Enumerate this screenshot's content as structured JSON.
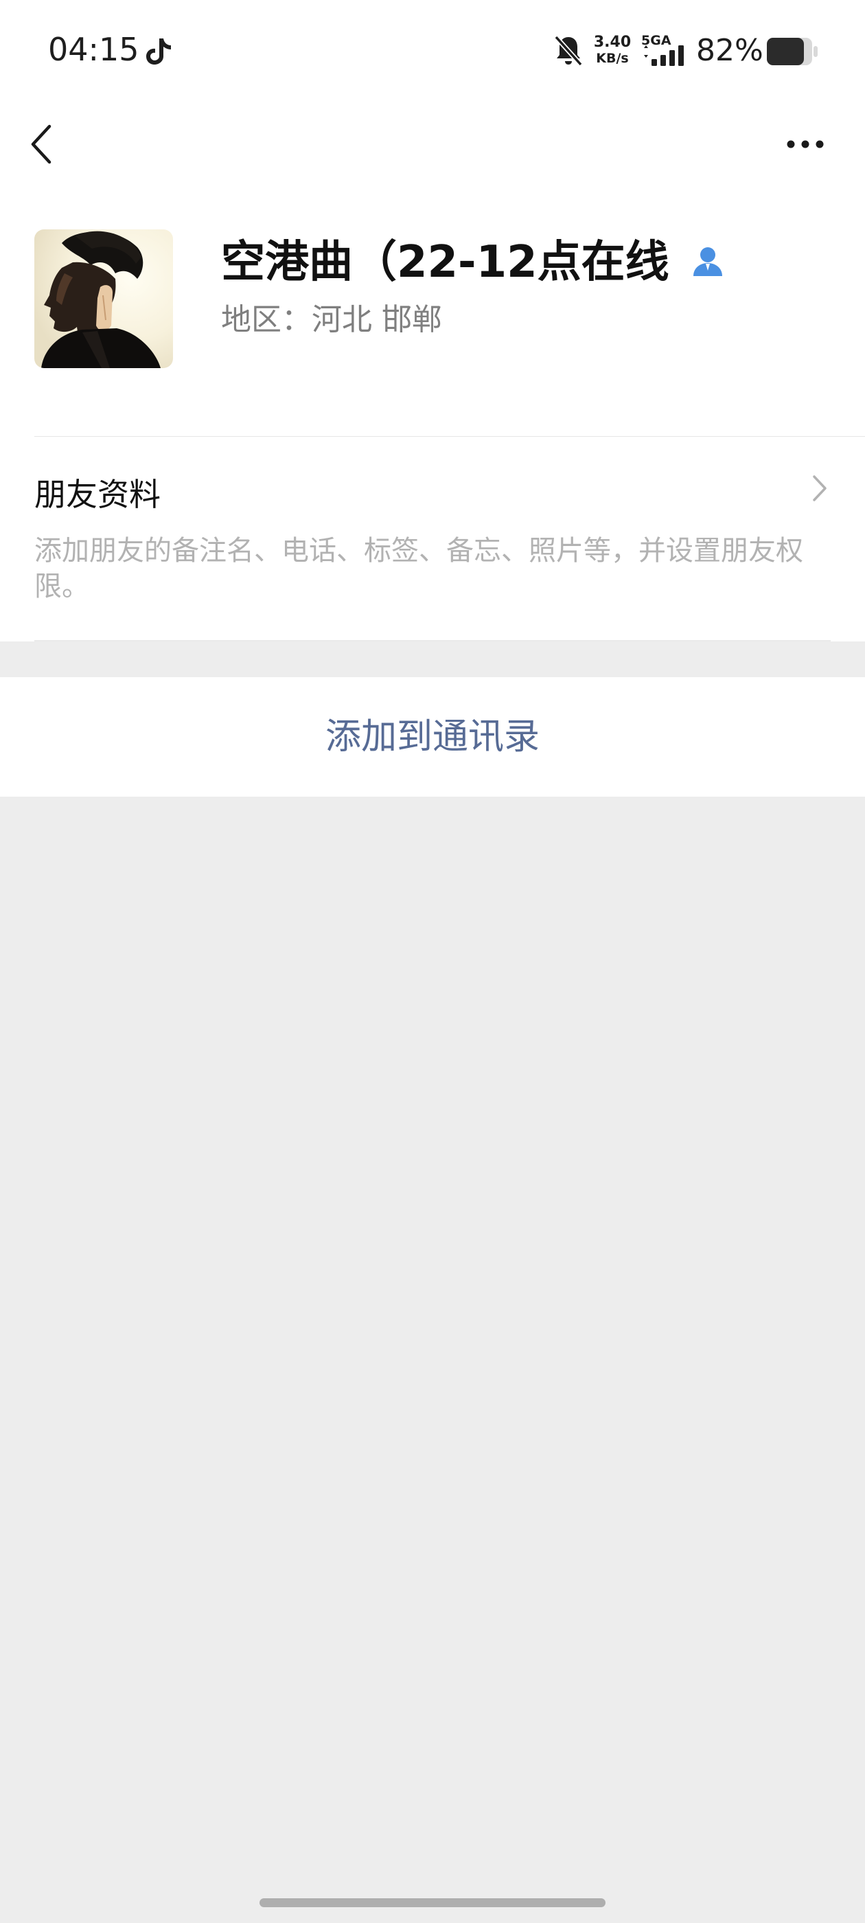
{
  "status_bar": {
    "time": "04:15",
    "net_speed_value": "3.40",
    "net_speed_unit": "KB/s",
    "network_type": "5GA",
    "battery_percent": "82%",
    "battery_level": 0.82,
    "icons": [
      "tiktok-icon",
      "bell-off-icon",
      "signal-icon",
      "battery-icon"
    ]
  },
  "nav": {
    "back_icon": "chevron-left-icon",
    "more_icon": "more-horizontal-icon"
  },
  "profile": {
    "nickname": "空港曲（22-12点在线",
    "region": "地区：河北  邯郸",
    "badge_icon": "contact-person-icon",
    "badge_color": "#4a90e2"
  },
  "friend_info": {
    "title": "朋友资料",
    "description": "添加朋友的备注名、电话、标签、备忘、照片等，并设置朋友权限。"
  },
  "actions": {
    "add_to_contacts": "添加到通讯录"
  },
  "colors": {
    "background": "#ededed",
    "link": "#576b95",
    "secondary_text": "#7f7f7f",
    "hint_text": "#b2b2b2"
  }
}
